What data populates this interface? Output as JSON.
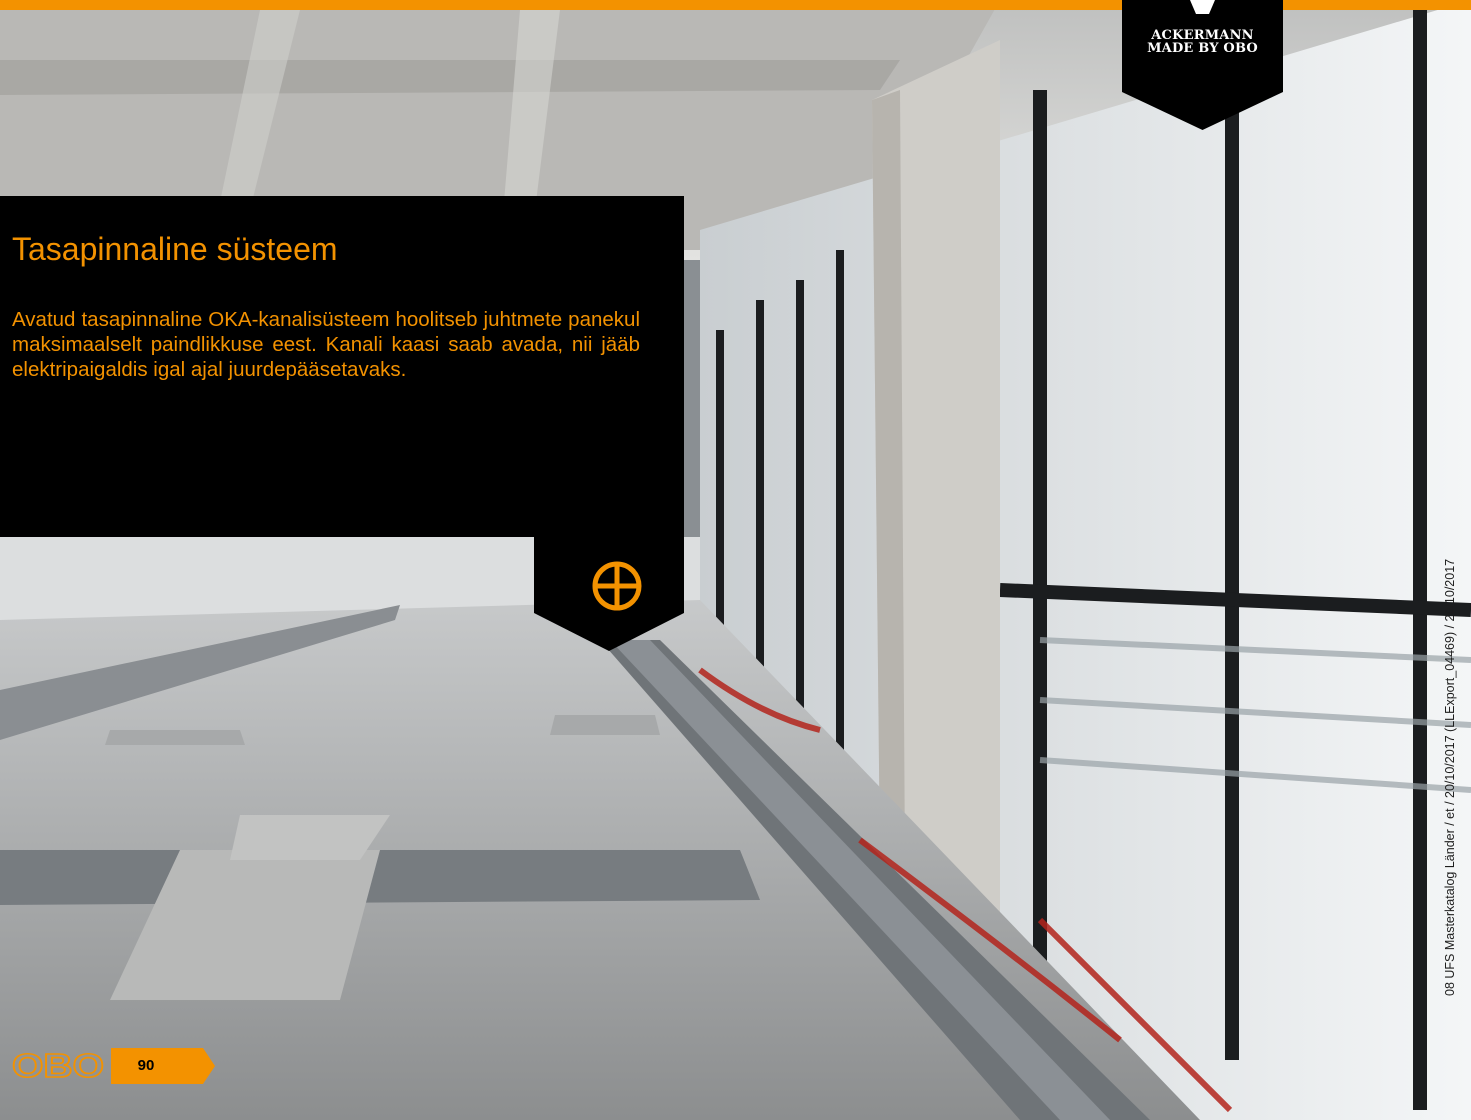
{
  "badge": {
    "line1": "ACKERMANN",
    "line2": "MADE BY OBO"
  },
  "info_box": {
    "title": "Tasapinnaline süsteem",
    "text": "Avatud tasapinnaline OKA-kanalisüsteem hoolitseb juhtmete panekul maksimaalselt paindlikkuse eest. Kanali kaasi saab avada, nii jääb elektripaigaldis igal ajal juurdepääsetavaks.",
    "expand_icon": "plus-circle-icon"
  },
  "footer": {
    "logo": "OBO",
    "page_number": "90"
  },
  "side_note": "08 UFS Masterkatalog Länder / et / 20/10/2017 (LLExport_04469) / 20/10/2017",
  "colors": {
    "accent": "#f39200",
    "box": "#000000"
  }
}
